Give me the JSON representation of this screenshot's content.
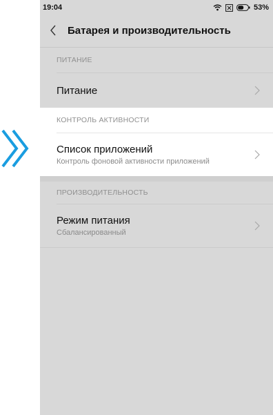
{
  "status_bar": {
    "time": "19:04",
    "battery_percent": "53%",
    "icons": [
      "wifi-icon",
      "sim-icon",
      "battery-icon"
    ]
  },
  "header": {
    "title": "Батарея и производительность"
  },
  "sections": [
    {
      "header": "ПИТАНИЕ",
      "items": [
        {
          "title": "Питание"
        }
      ]
    },
    {
      "header": "КОНТРОЛЬ АКТИВНОСТИ",
      "items": [
        {
          "title": "Список приложений",
          "subtitle": "Контроль фоновой активности приложений"
        }
      ]
    },
    {
      "header": "ПРОИЗВОДИТЕЛЬНОСТЬ",
      "items": [
        {
          "title": "Режим питания",
          "subtitle": "Сбалансированный"
        }
      ]
    }
  ],
  "colors": {
    "accent": "#1a9de0",
    "background": "#d8d8d8",
    "highlight": "#ffffff"
  }
}
